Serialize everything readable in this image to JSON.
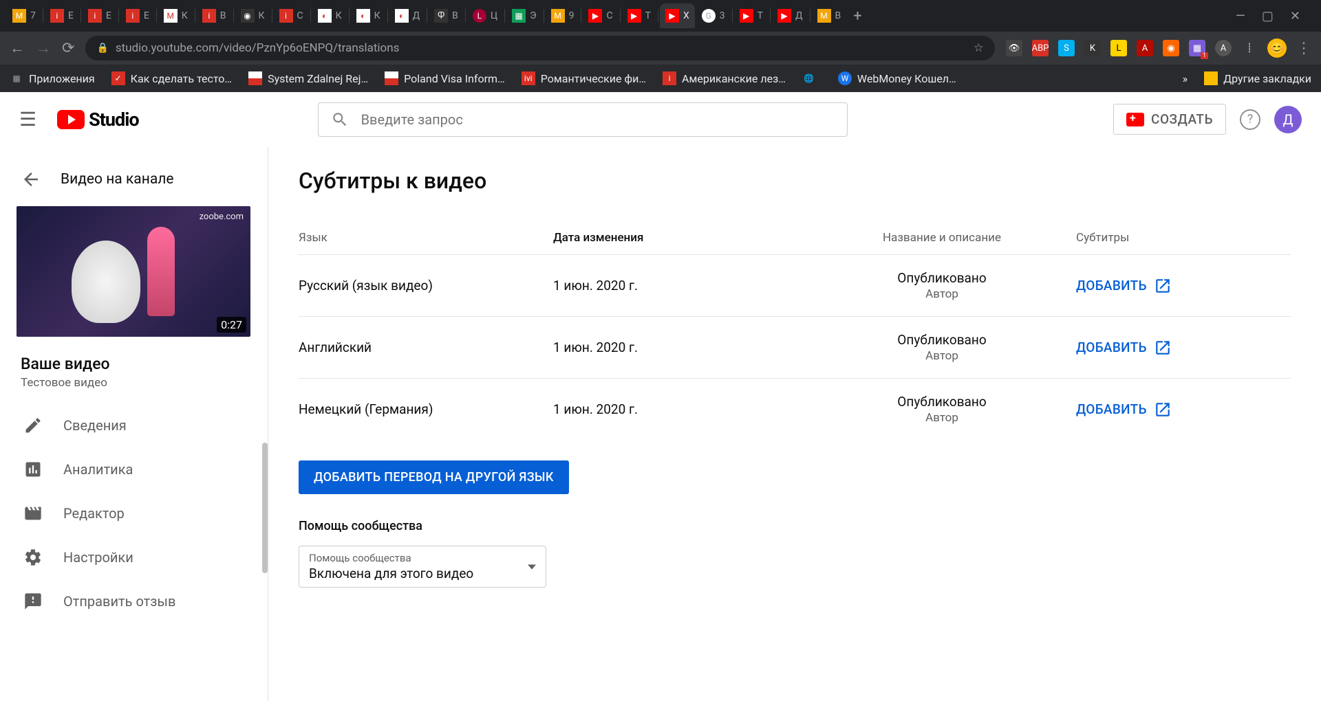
{
  "browser": {
    "tabs": [
      "7",
      "E",
      "E",
      "E",
      "К",
      "В",
      "К",
      "С",
      "К",
      "К",
      "Д",
      "В",
      "Ц",
      "Э",
      "9",
      "С",
      "Т",
      "X",
      "3",
      "Т",
      "Д",
      "B"
    ],
    "nav": {
      "back": true,
      "forward": true,
      "reload": true
    },
    "url": "studio.youtube.com/video/PznYp6oENPQ/translations",
    "star": "☆",
    "menu_dots": "⋮",
    "bookmarks": {
      "apps": "Приложения",
      "items": [
        "Как сделать тесто…",
        "System Zdalnej Rej…",
        "Poland Visa Inform…",
        "Романтические фи…",
        "Американские лез…",
        "",
        "WebMoney Кошел…"
      ],
      "overflow": "»",
      "other": "Другие закладки"
    }
  },
  "header": {
    "logo_text": "Studio",
    "search_placeholder": "Введите запрос",
    "create_label": "СОЗДАТЬ",
    "avatar_letter": "Д"
  },
  "sidebar": {
    "back_label": "Видео на канале",
    "thumb_watermark": "zoobe.com",
    "thumb_duration": "0:27",
    "video_title": "Ваше видео",
    "video_subtitle": "Тестовое видео",
    "nav": {
      "details": "Сведения",
      "analytics": "Аналитика",
      "editor": "Редактор",
      "settings": "Настройки",
      "feedback": "Отправить отзыв"
    }
  },
  "main": {
    "page_title": "Субтитры к видео",
    "columns": {
      "lang": "Язык",
      "date": "Дата изменения",
      "title": "Название и описание",
      "sub": "Субтитры"
    },
    "rows": [
      {
        "lang": "Русский (язык видео)",
        "date": "1 июн. 2020 г.",
        "status": "Опубликовано",
        "author": "Автор",
        "action": "ДОБАВИТЬ"
      },
      {
        "lang": "Английский",
        "date": "1 июн. 2020 г.",
        "status": "Опубликовано",
        "author": "Автор",
        "action": "ДОБАВИТЬ"
      },
      {
        "lang": "Немецкий (Германия)",
        "date": "1 июн. 2020 г.",
        "status": "Опубликовано",
        "author": "Автор",
        "action": "ДОБАВИТЬ"
      }
    ],
    "add_lang_button": "ДОБАВИТЬ ПЕРЕВОД НА ДРУГОЙ ЯЗЫК",
    "community": {
      "heading": "Помощь сообщества",
      "dropdown_label": "Помощь сообщества",
      "dropdown_value": "Включена для этого видео"
    }
  }
}
